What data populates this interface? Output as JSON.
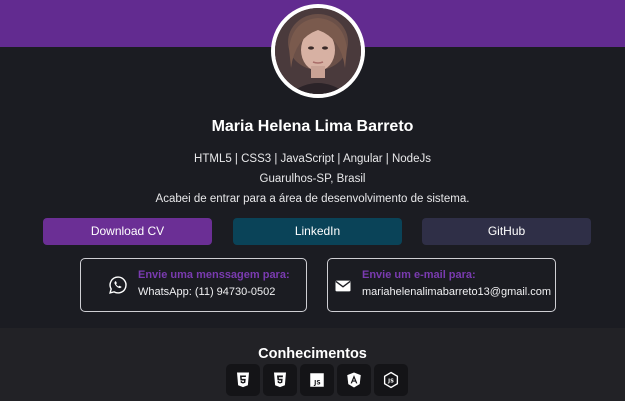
{
  "profile": {
    "name": "Maria Helena Lima Barreto",
    "stack": "HTML5 | CSS3 | JavaScript | Angular | NodeJs",
    "location": "Guarulhos-SP, Brasil",
    "bio": "Acabei de entrar para a área de desenvolvimento de sistema."
  },
  "buttons": {
    "download_cv": "Download CV",
    "linkedin": "LinkedIn",
    "github": "GitHub"
  },
  "contacts": {
    "whatsapp": {
      "label": "Envie uma menssagem para:",
      "value": "WhatsApp: (11) 94730-0502",
      "icon": "whatsapp-icon"
    },
    "email": {
      "label": "Envie um e-mail para:",
      "value": "mariahelenalimabarreto13@gmail.com",
      "icon": "envelope-icon"
    }
  },
  "skills": {
    "title": "Conhecimentos",
    "items": [
      "html5-icon",
      "css3-icon",
      "javascript-icon",
      "angular-icon",
      "nodejs-icon"
    ]
  },
  "colors": {
    "brand_purple": "#622b90",
    "label_purple": "#7a3bb0",
    "cv_button": "#6b2f95",
    "linkedin_button": "#0a4358",
    "github_button": "#2f2f47",
    "background": "#1b1c22"
  }
}
